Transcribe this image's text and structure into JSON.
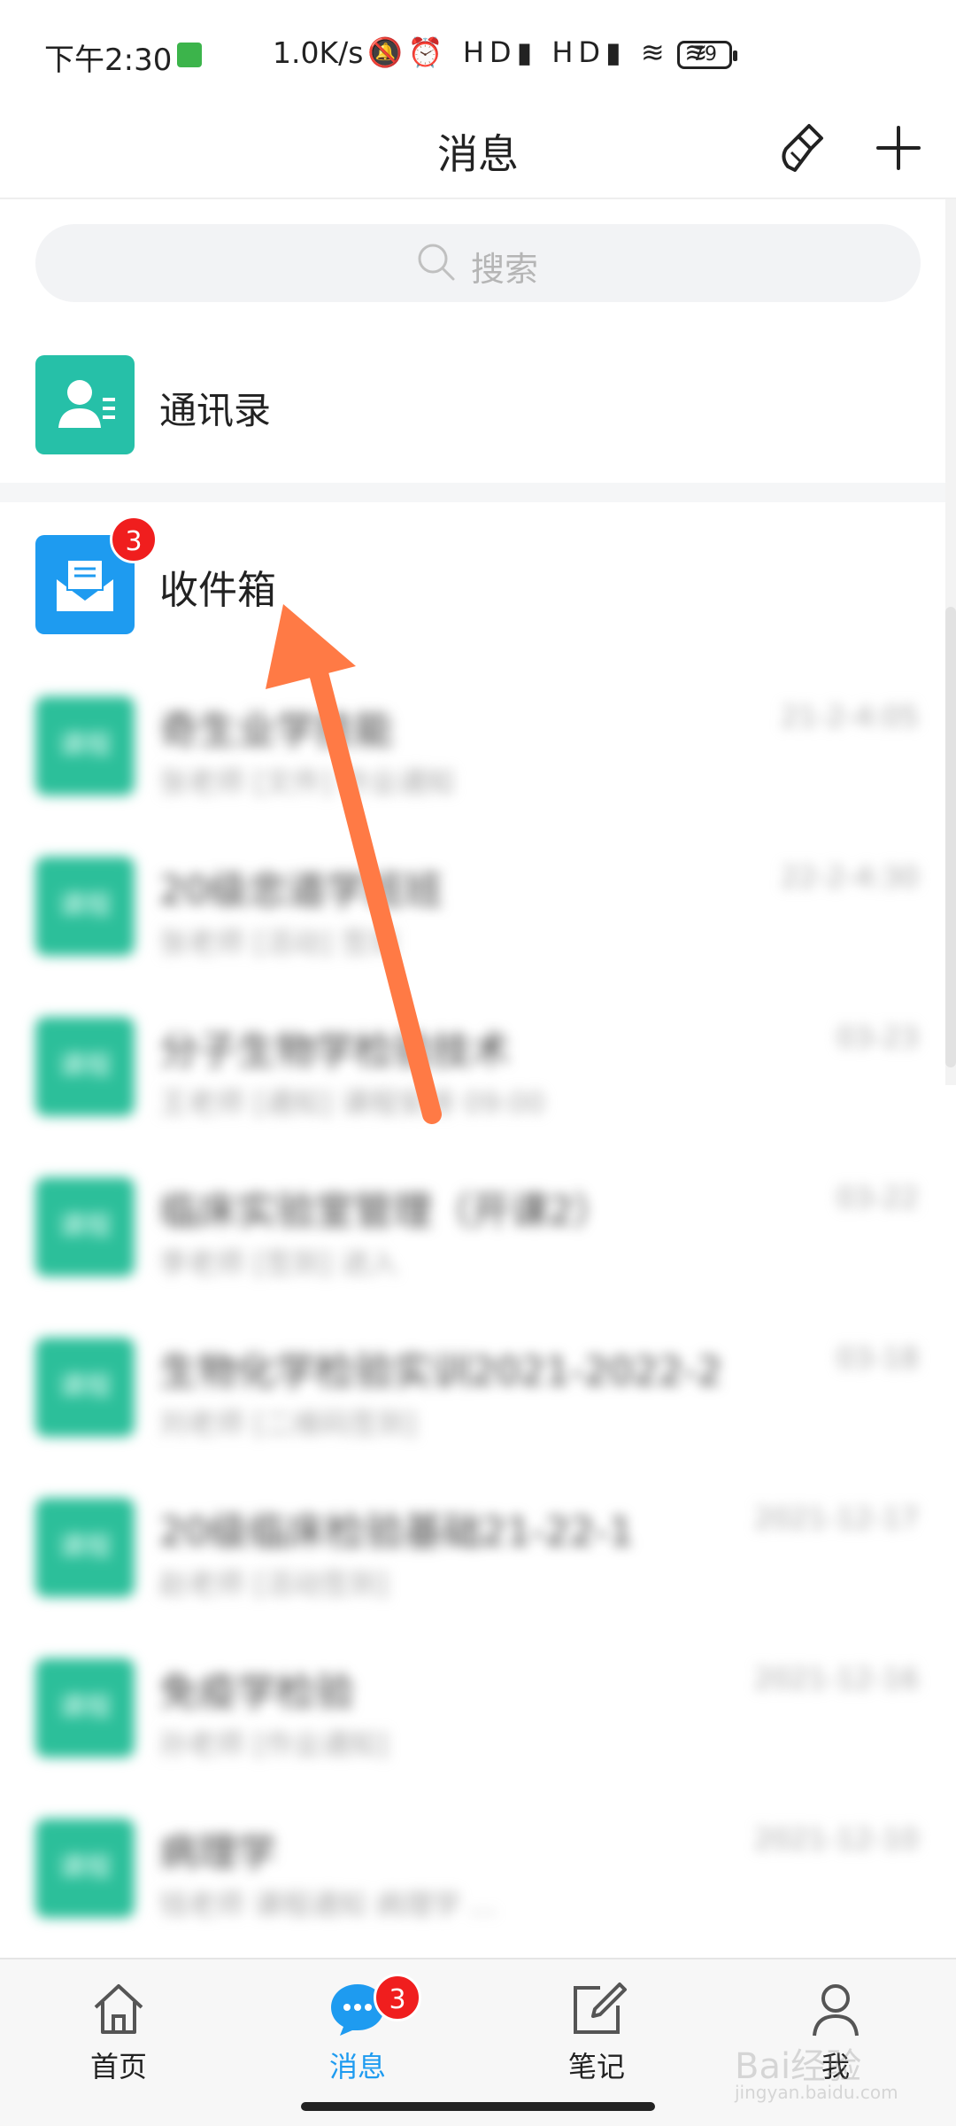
{
  "status_bar": {
    "time": "下午2:30",
    "net_speed": "1.0K/s",
    "indicators": "🔕⏰ HD▮ HD▮ ≋ ≋",
    "battery": "79"
  },
  "header": {
    "title": "消息",
    "clean_icon": "broom-icon",
    "add_icon": "plus-icon"
  },
  "search": {
    "placeholder": "搜索"
  },
  "contacts": {
    "label": "通讯录"
  },
  "inbox": {
    "label": "收件箱",
    "badge": "3"
  },
  "messages": [
    {
      "avatar": "课程",
      "name": "奇生业学技能",
      "preview": "张老师 [文件] 作业通知",
      "time": "21-2-4:05"
    },
    {
      "avatar": "课程",
      "name": "20级忠道学班班",
      "preview": "张老师 [活动] 签到",
      "time": "22-2-4:30"
    },
    {
      "avatar": "课程",
      "name": "分子生物学检验技术",
      "preview": "王老师 [通知] 课程安排 09:00",
      "time": "03-23"
    },
    {
      "avatar": "课程",
      "name": "临床实验室管理（开课2）",
      "preview": "李老师 [签到] 进入",
      "time": "03-22"
    },
    {
      "avatar": "课程",
      "name": "生物化学检验实训2021-2022-2",
      "preview": "刘老师 [二维码签到]",
      "time": "03-18"
    },
    {
      "avatar": "课程",
      "name": "20级临床检验基础21-22-1",
      "preview": "赵老师 [活动签到]",
      "time": "2021-12-17"
    },
    {
      "avatar": "课程",
      "name": "免疫学检验",
      "preview": "孙老师 [作业通知]",
      "time": "2021-12-16"
    },
    {
      "avatar": "课程",
      "name": "病理学",
      "preview": "钱老师 课程通知 病理学 ...",
      "time": "2021-12-10"
    }
  ],
  "tabs": [
    {
      "label": "首页",
      "icon": "home-icon"
    },
    {
      "label": "消息",
      "icon": "chat-bubble-icon",
      "badge": "3"
    },
    {
      "label": "笔记",
      "icon": "note-edit-icon"
    },
    {
      "label": "我",
      "icon": "person-icon"
    }
  ],
  "watermark": {
    "text": "Bai经验",
    "sub": "jingyan.baidu.com"
  },
  "colors": {
    "accent": "#1e9bf0",
    "contacts_icon": "#26c0a8",
    "course_avatar": "#2cbf9a",
    "badge": "#f01e1e",
    "arrow": "#ff7a45"
  }
}
